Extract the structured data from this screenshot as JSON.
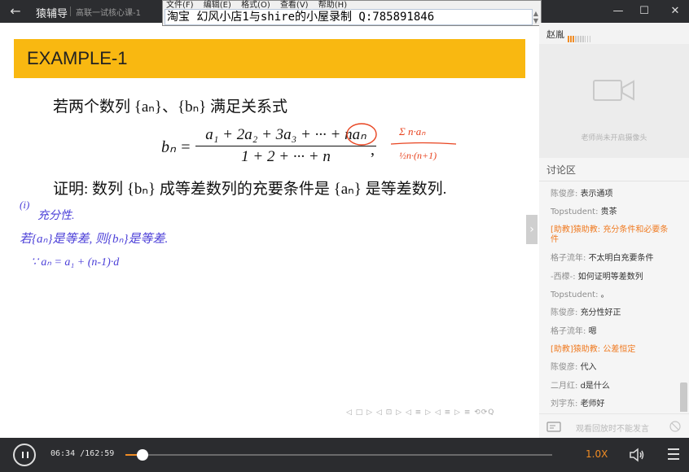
{
  "titlebar": {
    "app_title": "猿辅导",
    "course": "高联一试核心课-1"
  },
  "notepad": {
    "menus": [
      "文件(F)",
      "编辑(E)",
      "格式(O)",
      "查看(V)",
      "帮助(H)"
    ],
    "content": "淘宝 幻风小店1与shire的小屋录制 Q:785891846"
  },
  "slide": {
    "header": "EXAMPLE-1",
    "line1": "若两个数列 {aₙ}、{bₙ} 满足关系式",
    "formula": {
      "lhs": "bₙ =",
      "numerator": "a₁ + 2a₂ + 3a₃ + ··· + naₙ",
      "denominator": "1 + 2 + ··· + n",
      "trail": ","
    },
    "line3": "证明: 数列 {bₙ} 成等差数列的充要条件是 {aₙ} 是等差数列.",
    "annotations": {
      "red_num": "Σ n·aₙ",
      "red_den": "½n·(n+1)",
      "blue1": "(i)",
      "blue2": "充分性.",
      "blue3": "若{aₙ}是等差, 则{bₙ}是等差.",
      "blue4": "∵  aₙ = a₁ + (n-1)·d"
    },
    "nav": "◁ □ ▷ ◁ ⊡ ▷ ◁ ≡ ▷ ◁ ≡ ▷  ≡  ⟲⟳Q"
  },
  "right_panel": {
    "teacher": "赵胤",
    "camera_msg": "老师尚未开启摄像头",
    "discuss_title": "讨论区",
    "messages": [
      {
        "user": "陈俊彦:",
        "text": "表示通项",
        "assist": false
      },
      {
        "user": "Topstudent:",
        "text": "贵茶",
        "assist": false
      },
      {
        "user": "[助教]猿助教:",
        "text": "充分条件和必要条件",
        "assist": true
      },
      {
        "user": "格子流年:",
        "text": "不太明白充要条件",
        "assist": false
      },
      {
        "user": "-西檬-:",
        "text": "如何证明等差数列",
        "assist": false
      },
      {
        "user": "Topstudent:",
        "text": "。",
        "assist": false
      },
      {
        "user": "陈俊彦:",
        "text": "充分性好正",
        "assist": false
      },
      {
        "user": "格子流年:",
        "text": "嗯",
        "assist": false
      },
      {
        "user": "[助教]猿助教:",
        "text": "公差恒定",
        "assist": true
      },
      {
        "user": "陈俊彦:",
        "text": "代入",
        "assist": false
      },
      {
        "user": "二月红:",
        "text": "d是什么",
        "assist": false
      },
      {
        "user": "刘宇东:",
        "text": "老师好",
        "assist": false
      }
    ],
    "input_hint": "观看回放时不能发言"
  },
  "player": {
    "current": "06:34",
    "total": "/162:59",
    "speed": "1.0X",
    "progress_fraction": 0.04
  },
  "colors": {
    "accent": "#f08c24",
    "header": "#f9b811",
    "ink_blue": "#4b3fd8",
    "ink_red": "#e8431f"
  }
}
